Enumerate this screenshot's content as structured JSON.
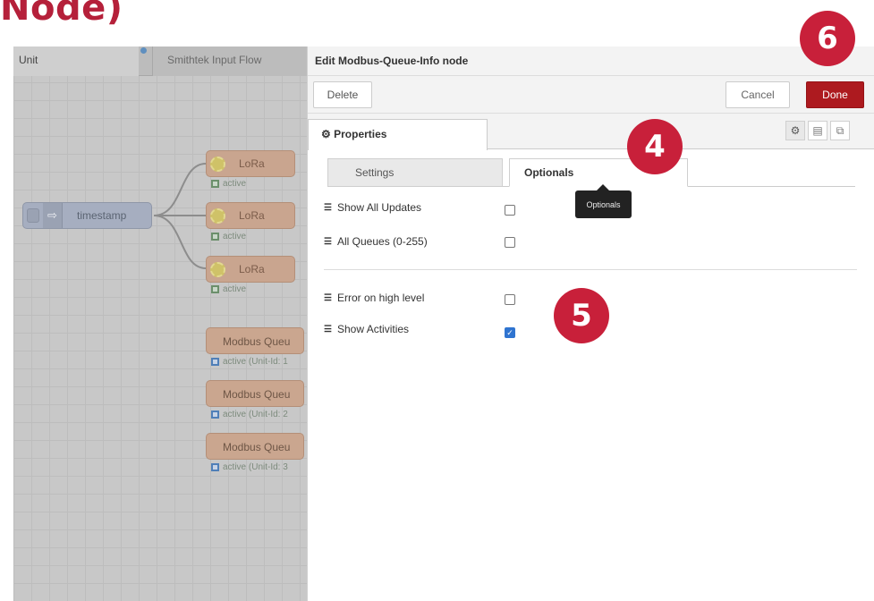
{
  "page_title": "Node)",
  "flow_tabs": [
    {
      "label": "Unit"
    },
    {
      "label": "Smithtek Input Flow"
    }
  ],
  "canvas": {
    "inject_label": "timestamp",
    "lora_nodes": [
      {
        "label": "LoRa",
        "status": "active"
      },
      {
        "label": "LoRa",
        "status": "active"
      },
      {
        "label": "LoRa",
        "status": "active"
      }
    ],
    "modbus_nodes": [
      {
        "label": "Modbus Queu",
        "status": "active (Unit-Id: 1"
      },
      {
        "label": "Modbus Queu",
        "status": "active (Unit-Id: 2"
      },
      {
        "label": "Modbus Queu",
        "status": "active (Unit-Id: 3"
      }
    ]
  },
  "editor": {
    "title": "Edit Modbus-Queue-Info node",
    "delete_label": "Delete",
    "cancel_label": "Cancel",
    "done_label": "Done",
    "properties_tab": "Properties",
    "sub_tabs": {
      "settings": "Settings",
      "optionals": "Optionals"
    },
    "tooltip": "Optionals",
    "options": [
      {
        "label": "Show All Updates",
        "checked": false
      },
      {
        "label": "All Queues (0-255)",
        "checked": false
      },
      {
        "label": "Error on high level",
        "checked": false
      },
      {
        "label": "Show Activities",
        "checked": true
      }
    ]
  },
  "badges": {
    "four": "4",
    "five": "5",
    "six": "6"
  },
  "colors": {
    "brand": "#c8203a",
    "done": "#ad1a1f",
    "checkbox": "#2f74d0"
  }
}
